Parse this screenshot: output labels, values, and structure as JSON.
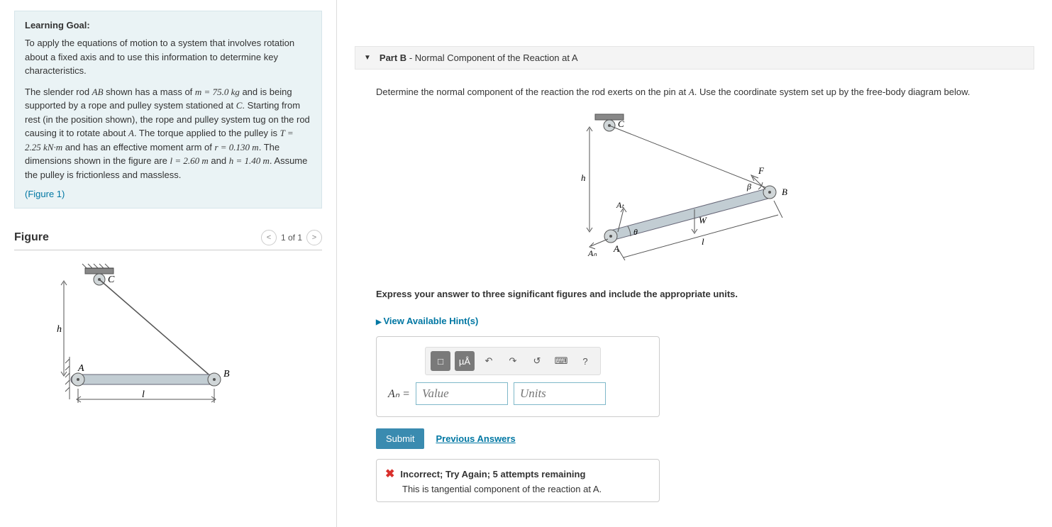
{
  "goal": {
    "heading": "Learning Goal:",
    "p1": "To apply the equations of motion to a system that involves rotation about a fixed axis and to use this information to determine key characteristics.",
    "p2_prefix": "The slender rod ",
    "p2_var_ab": "AB",
    "p2_a": " shown has a mass of ",
    "p2_m": "m = 75.0 kg",
    "p2_b": " and is being supported by a rope and pulley system stationed at ",
    "p2_var_c": "C",
    "p2_c": ". Starting from rest (in the position shown), the rope and pulley system tug on the rod causing it to rotate about ",
    "p2_var_a": "A",
    "p2_d": ". The torque applied to the pulley is ",
    "p2_t": "T = 2.25 kN·m",
    "p2_e": " and has an effective moment arm of ",
    "p2_r": "r = 0.130 m",
    "p2_f": ". The dimensions shown in the figure are ",
    "p2_l": "l = 2.60 m",
    "p2_g": " and ",
    "p2_h": "h = 1.40 m",
    "p2_end": ". Assume the pulley is frictionless and massless.",
    "figlink": "(Figure 1)"
  },
  "figure": {
    "heading": "Figure",
    "pager": "1 of 1"
  },
  "part": {
    "label": "Part B",
    "title": " - Normal Component of the Reaction at A"
  },
  "question": {
    "prompt_a": "Determine the normal component of the reaction the rod exerts on the pin at ",
    "prompt_var": "A",
    "prompt_b": ". Use the coordinate system set up by the free-body diagram below.",
    "express": "Express your answer to three significant figures and include the appropriate units.",
    "hints": "View Available Hint(s)"
  },
  "answer": {
    "lhs": "Aₙ =",
    "value_ph": "Value",
    "units_ph": "Units",
    "submit": "Submit",
    "prev": "Previous Answers",
    "tb_frac": "□",
    "tb_ua": "µÅ",
    "tb_undo": "↶",
    "tb_redo": "↷",
    "tb_reset": "↺",
    "tb_kbd": "⌨",
    "tb_help": "?"
  },
  "feedback": {
    "head": "Incorrect; Try Again; 5 attempts remaining",
    "sub": "This is tangential component of the reaction at A."
  },
  "svg_labels": {
    "C": "C",
    "A": "A",
    "B": "B",
    "h": "h",
    "l": "l",
    "At": "Aₜ",
    "An": "Aₙ",
    "F": "F",
    "W": "W",
    "beta": "β",
    "theta": "θ"
  }
}
